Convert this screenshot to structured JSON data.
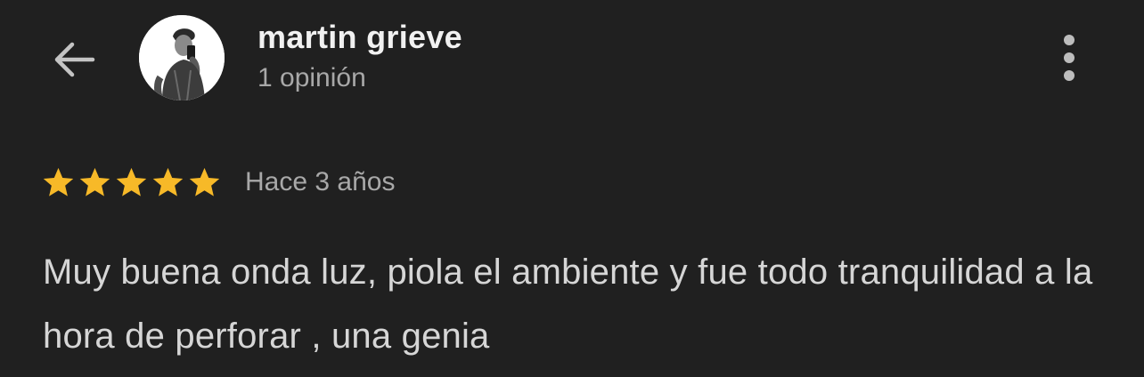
{
  "header": {
    "back_icon": "arrow-back-icon",
    "reviewer_name": "martin grieve",
    "review_count": "1 opinión",
    "more_icon": "more-vert-icon"
  },
  "review": {
    "rating": 5,
    "rating_max": 5,
    "date": "Hace 3 años",
    "text": "Muy buena onda luz, piola el ambiente y fue todo tranquilidad a la hora de perforar , una genia"
  },
  "colors": {
    "background": "#202020",
    "star": "#F7B928",
    "primary_text": "#F1F1F1",
    "secondary_text": "#A8A8A8",
    "body_text": "#D6D6D6"
  }
}
